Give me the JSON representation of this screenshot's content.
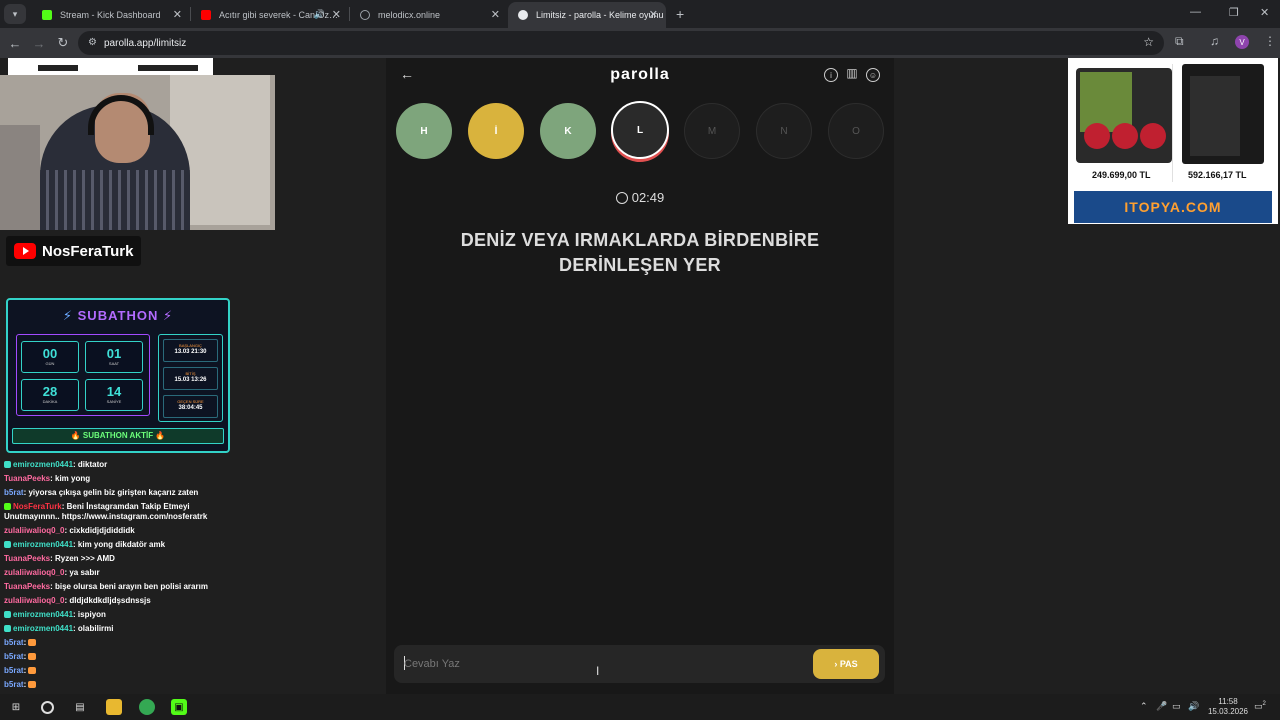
{
  "browser": {
    "tabs": [
      {
        "title": "Stream - Kick Dashboard",
        "active": false,
        "color": "#53fc18"
      },
      {
        "title": "Acıtır gibi severek - Can Oz…",
        "active": false,
        "color": "#ff0000"
      },
      {
        "title": "melodicx.online",
        "active": false,
        "color": "#9aa0a6"
      },
      {
        "title": "Limitsiz - parolla - Kelime oyunu",
        "active": true,
        "color": "#e8eaed"
      }
    ],
    "url": "parolla.app/limitsiz",
    "profile_initial": "V"
  },
  "stream": {
    "channel_name": "NosFeraTurk",
    "subathon": {
      "title": "SUBATHON",
      "counters": [
        {
          "value": "00",
          "label": "GÜN"
        },
        {
          "value": "01",
          "label": "SAAT"
        },
        {
          "value": "28",
          "label": "DAKİKA"
        },
        {
          "value": "14",
          "label": "SANİYE"
        }
      ],
      "info": [
        {
          "title": "BAŞLANGIÇ",
          "value": "13.03 21:30"
        },
        {
          "title": "BİTİŞ",
          "value": "15.03 13:26"
        },
        {
          "title": "GEÇEN SÜRE",
          "value": "38:04:45"
        }
      ],
      "status": "🔥 SUBATHON AKTİF 🔥"
    },
    "chat": [
      {
        "user": "emirozmen0441",
        "text": "diktator",
        "color": "cyan"
      },
      {
        "user": "TuanaPeeks",
        "text": "kim yong",
        "color": "pink"
      },
      {
        "user": "b5rat",
        "text": "yiyorsa çıkışa gelin biz girişten kaçarız zaten",
        "color": "blue"
      },
      {
        "user": "NosFeraTurk",
        "text": "Beni İnstagramdan Takip Etmeyi Unutmayınnn.. https://www.instagram.com/nosferatrk",
        "color": "red"
      },
      {
        "user": "zulaliiwalioq0_0",
        "text": "cixkdidjdjdiddidk",
        "color": "pink"
      },
      {
        "user": "emirozmen0441",
        "text": "kim yong dikdatör amk",
        "color": "cyan"
      },
      {
        "user": "TuanaPeeks",
        "text": "Ryzen >>> AMD",
        "color": "pink"
      },
      {
        "user": "zulaliiwalioq0_0",
        "text": "ya sabır",
        "color": "pink"
      },
      {
        "user": "TuanaPeeks",
        "text": "bişe olursa beni arayın ben polisi ararım",
        "color": "pink"
      },
      {
        "user": "zulaliiwalioq0_0",
        "text": "dldjdkdkdljdşsdnssjs",
        "color": "pink"
      },
      {
        "user": "emirozmen0441",
        "text": "ispiyon",
        "color": "cyan"
      },
      {
        "user": "emirozmen0441",
        "text": "olabilirmi",
        "color": "cyan"
      },
      {
        "user": "b5rat",
        "text": "",
        "color": "blue"
      },
      {
        "user": "b5rat",
        "text": "",
        "color": "blue"
      },
      {
        "user": "b5rat",
        "text": "",
        "color": "blue"
      },
      {
        "user": "b5rat",
        "text": "",
        "color": "blue"
      }
    ]
  },
  "game": {
    "title": "parolla",
    "letters": [
      {
        "letter": "H",
        "state": "correct"
      },
      {
        "letter": "İ",
        "state": "passed"
      },
      {
        "letter": "K",
        "state": "correct"
      },
      {
        "letter": "L",
        "state": "current"
      },
      {
        "letter": "M",
        "state": "pending"
      },
      {
        "letter": "N",
        "state": "pending"
      },
      {
        "letter": "O",
        "state": "pending"
      }
    ],
    "timer": "02:49",
    "question": "DENİZ VEYA IRMAKLARDA BİRDENBİRE DERİNLEŞEN YER",
    "answer_placeholder": "Cevabı Yaz",
    "pass_label": "PAS"
  },
  "ad": {
    "products": [
      {
        "price": "249.699,00 TL"
      },
      {
        "price": "592.166,17 TL"
      }
    ],
    "brand": "ITOPYA.COM"
  },
  "taskbar": {
    "time": "11:58",
    "date": "15.03.2026",
    "notification_count": "2"
  },
  "colors": {
    "correct": "#7ea57c",
    "passed": "#d9b33d",
    "accent": "#d9b33d"
  }
}
